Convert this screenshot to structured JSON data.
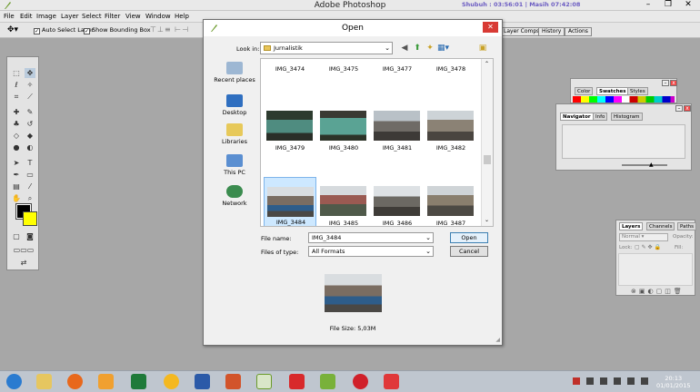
{
  "app": {
    "title": "Adobe Photoshop",
    "status_text": "Shubuh : 03:56:01 | Masih 07:42:08",
    "win_minimize": "–",
    "win_restore": "❐",
    "win_close": "✕"
  },
  "menubar": {
    "items": [
      "File",
      "Edit",
      "Image",
      "Layer",
      "Select",
      "Filter",
      "View",
      "Window",
      "Help"
    ]
  },
  "options": {
    "auto_select": "Auto Select Layer",
    "show_bbox": "Show Bounding Box",
    "tabs": [
      "Layer Comps",
      "History",
      "Actions"
    ]
  },
  "dialog": {
    "title": "Open",
    "close": "✕",
    "lookin_label": "Look in:",
    "lookin_value": "Jurnalistik",
    "places": [
      "Recent places",
      "Desktop",
      "Libraries",
      "This PC",
      "Network"
    ],
    "files": [
      {
        "name": "IMG_3474",
        "selected": false
      },
      {
        "name": "IMG_3475",
        "selected": false
      },
      {
        "name": "IMG_3477",
        "selected": false
      },
      {
        "name": "IMG_3478",
        "selected": false
      },
      {
        "name": "IMG_3479",
        "selected": false
      },
      {
        "name": "IMG_3480",
        "selected": false
      },
      {
        "name": "IMG_3481",
        "selected": false
      },
      {
        "name": "IMG_3482",
        "selected": false
      },
      {
        "name": "IMG_3484",
        "selected": true
      },
      {
        "name": "IMG_3485",
        "selected": false
      },
      {
        "name": "IMG_3486",
        "selected": false
      },
      {
        "name": "IMG_3487",
        "selected": false
      }
    ],
    "filename_label": "File name:",
    "filename_value": "IMG_3484",
    "filetype_label": "Files of type:",
    "filetype_value": "All Formats",
    "open_button": "Open",
    "cancel_button": "Cancel",
    "file_size": "File Size: 5,03M"
  },
  "panels": {
    "swatches_tabs": [
      "Color",
      "Swatches",
      "Styles"
    ],
    "navigator_tabs": [
      "Navigator",
      "Info",
      "Histogram"
    ],
    "layers_tabs": [
      "Layers",
      "Channels",
      "Paths"
    ],
    "layers_blend": "Normal",
    "layers_opacity": "Opacity:",
    "layers_lock": "Lock:",
    "layers_fill": "Fill:"
  },
  "taskbar": {
    "time": "20:13",
    "date": "01/01/2015"
  },
  "colors": {
    "foreground": "#000000",
    "background": "#ffff00",
    "accent": "#3c7fb1",
    "selection": "#cde8ff"
  }
}
